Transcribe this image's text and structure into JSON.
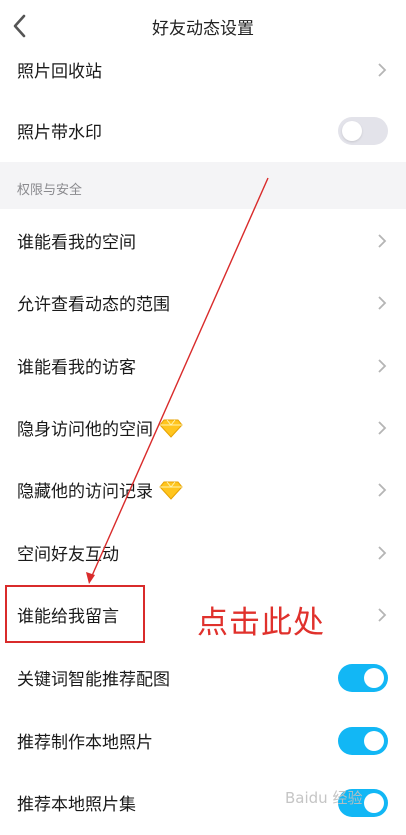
{
  "header": {
    "title": "好友动态设置"
  },
  "rows_top": [
    {
      "label": "照片回收站",
      "control": "chevron"
    },
    {
      "label": "照片带水印",
      "control": "toggle",
      "state": "off"
    }
  ],
  "section": {
    "label": "权限与安全"
  },
  "rows_security": [
    {
      "label": "谁能看我的空间",
      "control": "chevron"
    },
    {
      "label": "允许查看动态的范围",
      "control": "chevron"
    },
    {
      "label": "谁能看我的访客",
      "control": "chevron"
    },
    {
      "label": "隐身访问他的空间",
      "control": "chevron",
      "badge": "diamond-icon"
    },
    {
      "label": "隐藏他的访问记录",
      "control": "chevron",
      "badge": "diamond-icon"
    },
    {
      "label": "空间好友互动",
      "control": "chevron"
    },
    {
      "label": "谁能给我留言",
      "control": "chevron"
    },
    {
      "label": "关键词智能推荐配图",
      "control": "toggle",
      "state": "on"
    },
    {
      "label": "推荐制作本地照片",
      "control": "toggle",
      "state": "on"
    },
    {
      "label": "推荐本地照片集",
      "control": "toggle",
      "state": "on"
    }
  ],
  "annotation": {
    "text": "点击此处",
    "color": "#e0312c"
  },
  "watermark": {
    "text": "Baidu 经验"
  },
  "colors": {
    "accent": "#12b7f5",
    "toggle_off": "#e3e3ea",
    "section_bg": "#f4f4f6"
  }
}
